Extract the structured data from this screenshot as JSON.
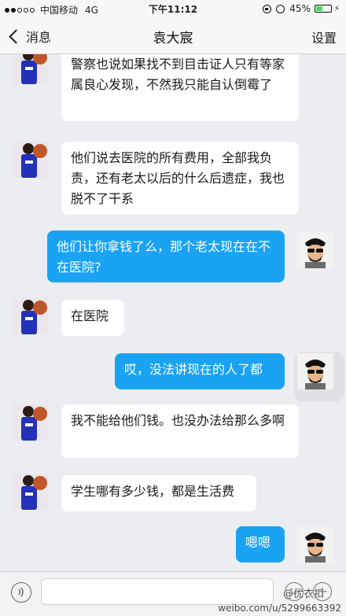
{
  "status_bar": {
    "carrier": "中国移动",
    "network": "4G",
    "time": "下午11:12",
    "battery": "45%",
    "battery_level": 0.45
  },
  "nav": {
    "back_label": "消息",
    "title": "袁大宸",
    "settings_label": "设置"
  },
  "messages": [
    {
      "from": "contact",
      "text": "警察也说如果找不到目击证人只有等家属良心发现，不然我只能自认倒霉了"
    },
    {
      "from": "contact",
      "text": "他们说去医院的所有费用，全部我负责，还有老太以后的什么后遗症，我也脱不了干系"
    },
    {
      "from": "me",
      "text": "他们让你拿钱了么，那个老太现在在不在医院?"
    },
    {
      "from": "contact",
      "text": "在医院"
    },
    {
      "from": "me",
      "text": "哎，没法讲现在的人了都"
    },
    {
      "from": "contact",
      "text": "我不能给他们钱。也没办法给那么多啊"
    },
    {
      "from": "contact",
      "text": "学生哪有多少钱，都是生活费"
    },
    {
      "from": "me",
      "text": "嗯嗯"
    }
  ],
  "watermark": {
    "handle": "@优衣扣",
    "url": "weibo.com/u/5299663392"
  },
  "colors": {
    "outgoing_bubble": "#1aa2f3",
    "incoming_bubble": "#ffffff",
    "background": "#ecedf1"
  }
}
